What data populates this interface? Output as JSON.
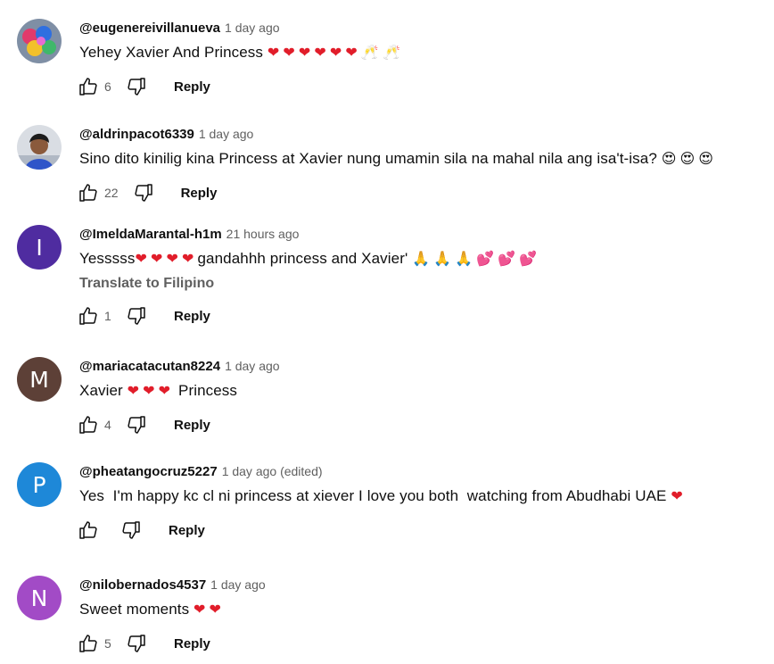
{
  "reply_label": "Reply",
  "translate_label": "Translate to Filipino",
  "colors": {
    "heart": "#e11d2a",
    "avatar_i": "#4f2ca0",
    "avatar_m": "#5d4037",
    "avatar_p": "#1e88d8",
    "avatar_n": "#a24bc6"
  },
  "comments": [
    {
      "author": "@eugenereivillanueva",
      "time": "1 day ago",
      "text": "Yehey Xavier And Princess",
      "emojis": [
        "❤",
        "❤",
        "❤",
        "❤",
        "❤",
        "❤",
        "🥂",
        "🥂"
      ],
      "likes": "6",
      "avatar_type": "photo",
      "avatar_icon": "colorful-photo-avatar"
    },
    {
      "author": "@aldrinpacot6339",
      "time": "1 day ago",
      "text": "Sino dito kinilig kina Princess at Xavier nung umamin sila na mahal nila ang isa't-isa?",
      "emojis": [
        "😍",
        "😍",
        "😍"
      ],
      "likes": "22",
      "avatar_type": "photo",
      "avatar_icon": "person-photo-avatar"
    },
    {
      "author": "@ImeldaMarantal-h1m",
      "time": "21 hours ago",
      "text": "Yesssss",
      "emojis": [
        "❤",
        "❤",
        "❤",
        "❤"
      ],
      "text_after": "gandahhh princess and Xavier'",
      "emojis_after": [
        "🙏",
        "🙏",
        "🙏",
        "💕",
        "💕",
        "💕"
      ],
      "likes": "1",
      "avatar_letter": "I",
      "show_translate": true
    },
    {
      "author": "@mariacatacutan8224",
      "time": "1 day ago",
      "text": "Xavier",
      "emojis": [
        "❤",
        "❤",
        "❤"
      ],
      "text_after": "Princess",
      "likes": "4",
      "avatar_letter": "M"
    },
    {
      "author": "@pheatangocruz5227",
      "time": "1 day ago (edited)",
      "text": "Yes  I'm happy kc cl ni princess at xiever I love you both  watching from Abudhabi UAE",
      "emojis": [
        "❤"
      ],
      "likes": "",
      "avatar_letter": "P"
    },
    {
      "author": "@nilobernados4537",
      "time": "1 day ago",
      "text": "Sweet moments",
      "emojis": [
        "❤",
        "❤"
      ],
      "likes": "5",
      "avatar_letter": "N"
    }
  ]
}
